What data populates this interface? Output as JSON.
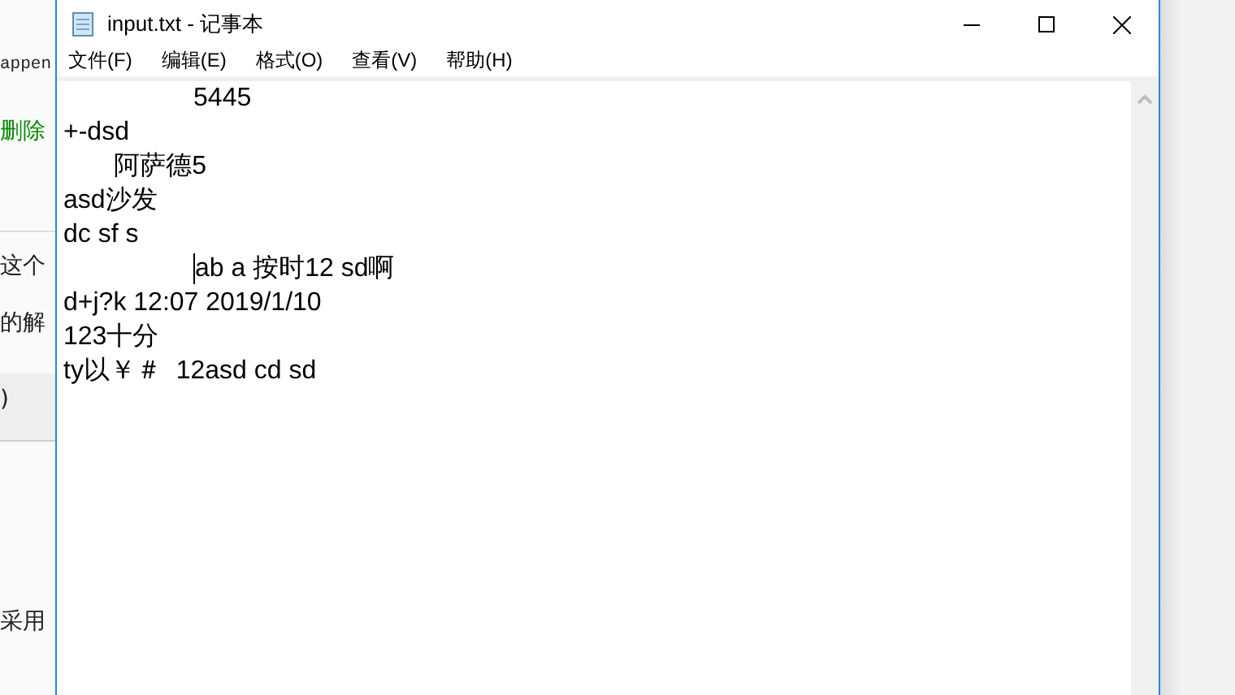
{
  "background_page": {
    "texts": [
      {
        "text": "appen",
        "kind": "code"
      },
      {
        "text": "删除",
        "kind": "green"
      },
      {
        "text": "这个",
        "kind": "plain"
      },
      {
        "text": "的解",
        "kind": "plain"
      },
      {
        "text": ")",
        "kind": "plain"
      },
      {
        "text": "采用",
        "kind": "plain"
      }
    ]
  },
  "window": {
    "title": "input.txt - 记事本"
  },
  "menu": [
    "文件(F)",
    "编辑(E)",
    "格式(O)",
    "查看(V)",
    "帮助(H)"
  ],
  "lines": [
    {
      "text": "                  5445",
      "caret": false
    },
    {
      "text": "+-dsd",
      "caret": false
    },
    {
      "text": "       阿萨德5",
      "caret": false
    },
    {
      "text": "asd沙发",
      "caret": false
    },
    {
      "text": "dc sf s",
      "caret": false
    },
    {
      "text": "                  ab a 按时12 sd啊",
      "caret": true
    },
    {
      "text": "d+j?k 12:07 2019/1/10",
      "caret": false
    },
    {
      "text": "123十分",
      "caret": false
    },
    {
      "text": "ty以￥＃  12asd cd sd",
      "caret": false
    }
  ]
}
